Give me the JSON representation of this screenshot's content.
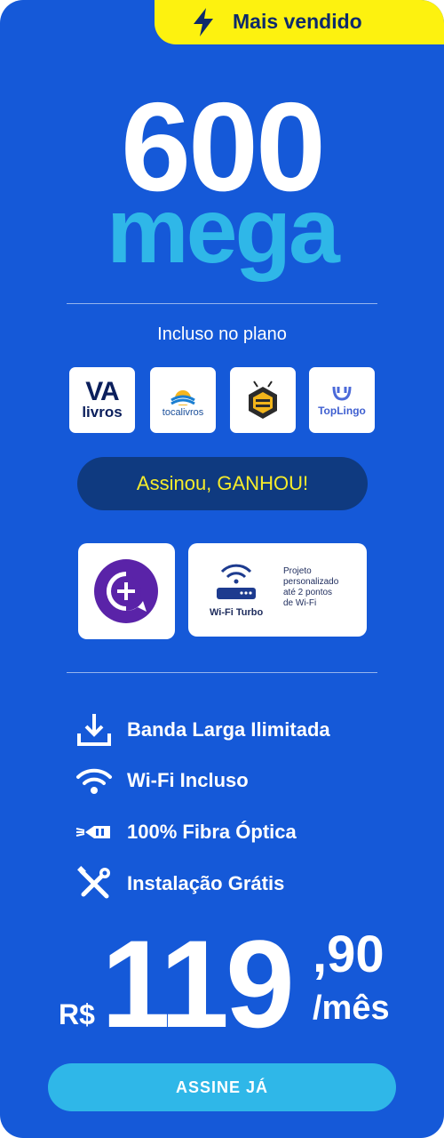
{
  "badge": {
    "label": "Mais vendido",
    "icon": "lightning-bolt-icon"
  },
  "plan": {
    "speed": "600",
    "unit": "mega"
  },
  "included": {
    "title": "Incluso no plano",
    "apps": [
      {
        "name": "va-livros-logo",
        "line1": "VA",
        "line2": "livros"
      },
      {
        "name": "tocalivros-logo",
        "line1": "tocalivros"
      },
      {
        "name": "bee-app-logo"
      },
      {
        "name": "toplingo-logo",
        "line1": "TopLingo"
      }
    ]
  },
  "bonus": {
    "banner": "Assinou, GANHOU!",
    "wifi_label": "Wi-Fi Turbo",
    "wifi_desc": [
      "Projeto",
      "personalizado",
      "até 2 pontos",
      "de Wi-Fi"
    ]
  },
  "features": [
    {
      "icon": "download-icon",
      "label": "Banda Larga Ilimitada"
    },
    {
      "icon": "wifi-icon",
      "label": "Wi-Fi Incluso"
    },
    {
      "icon": "fiber-optic-icon",
      "label": "100% Fibra Óptica"
    },
    {
      "icon": "tools-icon",
      "label": "Instalação Grátis"
    }
  ],
  "price": {
    "currency": "R$",
    "integer": "119",
    "decimal": ",90",
    "period": "/mês"
  },
  "cta": {
    "label": "ASSINE JÁ"
  },
  "colors": {
    "background": "#1559d8",
    "badge": "#fdf20f",
    "accent": "#2fb7e8",
    "highlight_text": "#f6ec2a"
  }
}
